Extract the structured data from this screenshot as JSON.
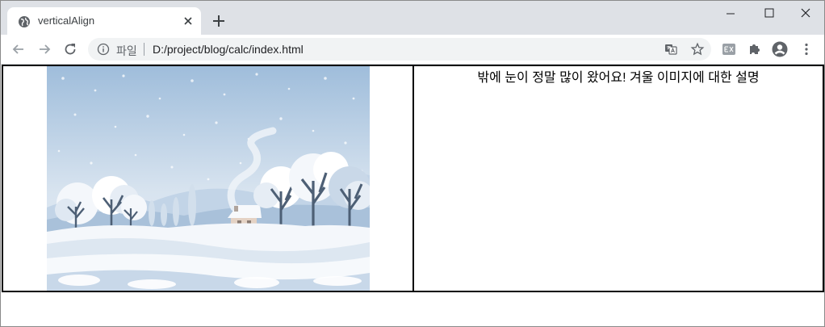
{
  "browser": {
    "tab": {
      "title": "verticalAlign"
    },
    "address": {
      "chip_label": "파일",
      "url": "D:/project/blog/calc/index.html"
    },
    "toolbar_icons": [
      "back-icon",
      "forward-icon",
      "reload-icon",
      "translate-icon",
      "star-icon",
      "extension-icon",
      "puzzle-icon",
      "profile-icon",
      "menu-icon"
    ]
  },
  "page": {
    "table": {
      "image_cell": {
        "image": "winter-landscape-illustration"
      },
      "text_cell": {
        "text": "밖에 눈이 정말 많이 왔어요! 겨울 이미지에 대한 설명"
      }
    }
  },
  "colors": {
    "tabstrip": "#dee1e6",
    "omnibox": "#f1f3f4",
    "sky": "#b9cde2",
    "snow": "#f4f7fb"
  }
}
